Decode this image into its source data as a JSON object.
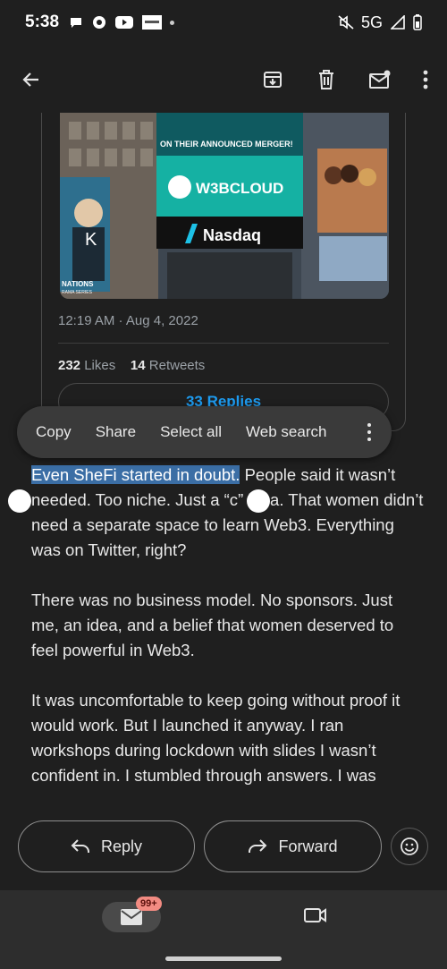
{
  "status_bar": {
    "time": "5:38",
    "network": "5G",
    "left_icons": [
      "chat-bubble-icon",
      "chrome-icon",
      "youtube-icon",
      "mighty-app-icon",
      "dot-icon"
    ],
    "right_icons": [
      "mute-icon",
      "signal-icon",
      "battery-icon"
    ]
  },
  "app_bar": {
    "icons": [
      "back-arrow-icon",
      "archive-icon",
      "delete-icon",
      "mark-unread-icon",
      "more-vert-icon"
    ]
  },
  "tweet": {
    "image_texts": {
      "banner": "ON THEIR ANNOUNCED MERGER!",
      "brand": "W3BCLOUD",
      "exchange": "Nasdaq",
      "left_letter": "K",
      "left_caption_1": "NATIONS",
      "left_caption_2": "RAMA SERIES"
    },
    "timestamp": "12:19 AM · Aug 4, 2022",
    "likes_count": "232",
    "likes_label": "Likes",
    "retweets_count": "14",
    "retweets_label": "Retweets",
    "replies_button": "33 Replies"
  },
  "selection_toolbar": {
    "copy": "Copy",
    "share": "Share",
    "select_all": "Select all",
    "web_search": "Web search"
  },
  "body": {
    "p1_selected": "Even SheFi started in doubt.",
    "p1_rest_a": " People said it wasn’t needed. Too niche. Just a “c",
    "p1_rest_b": "” idea. That women didn’t need a separate space to learn Web3. Everything was on Twitter, right?",
    "p2": "There was no business model. No sponsors. Just me, an idea, and a belief that women deserved to feel powerful in Web3.",
    "p3": "It was uncomfortable to keep going without proof it would work. But I launched it anyway. I ran workshops during lockdown with slides I wasn’t confident in. I stumbled through answers. I was"
  },
  "reply_bar": {
    "reply": "Reply",
    "forward": "Forward"
  },
  "bottom_nav": {
    "mail_badge": "99+"
  },
  "colors": {
    "background": "#1f1f1f",
    "selection_highlight": "#3b6ea5",
    "link_blue": "#1d9bf0",
    "badge": "#f28b82"
  }
}
